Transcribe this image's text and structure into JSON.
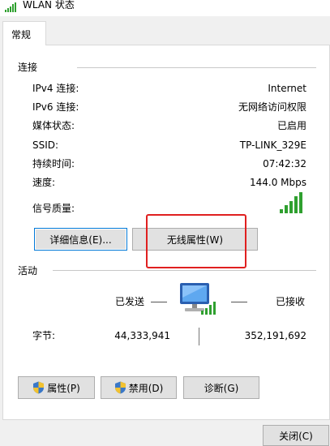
{
  "window": {
    "title": "WLAN 状态",
    "icon": "wifi-signal-icon"
  },
  "tabs": [
    {
      "label": "常规"
    }
  ],
  "connection": {
    "heading": "连接",
    "rows": [
      {
        "label": "IPv4 连接:",
        "value": "Internet"
      },
      {
        "label": "IPv6 连接:",
        "value": "无网络访问权限"
      },
      {
        "label": "媒体状态:",
        "value": "已启用"
      },
      {
        "label": "SSID:",
        "value": "TP-LINK_329E"
      },
      {
        "label": "持续时间:",
        "value": "07:42:32"
      },
      {
        "label": "速度:",
        "value": "144.0 Mbps"
      }
    ],
    "signal_label": "信号质量:",
    "signal_bars": 5
  },
  "buttons": {
    "details": "详细信息(E)...",
    "wireless_properties": "无线属性(W)"
  },
  "activity": {
    "heading": "活动",
    "sent_label": "已发送",
    "received_label": "已接收",
    "bytes_label": "字节:",
    "bytes_sent": "44,333,941",
    "bytes_received": "352,191,692"
  },
  "bottom_buttons": {
    "properties": "属性(P)",
    "disable": "禁用(D)",
    "diagnose": "诊断(G)"
  },
  "dialog": {
    "close": "关闭(C)"
  },
  "colors": {
    "accent": "#0078d7",
    "signal": "#2fa02f",
    "highlight": "#e02020"
  }
}
